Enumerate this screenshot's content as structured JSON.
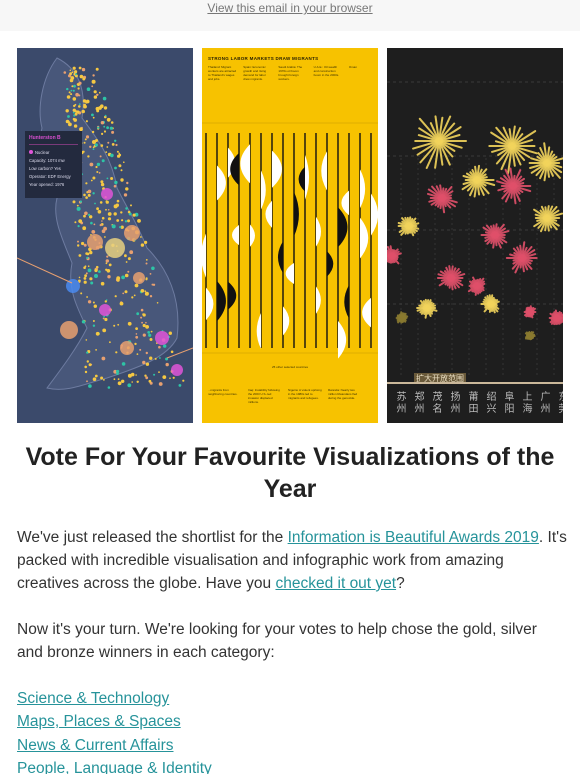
{
  "header": {
    "view_in_browser": "View this email in your browser"
  },
  "images": [
    {
      "name": "uk-power-map",
      "tooltip": {
        "title": "Hunterston B",
        "type": "Nuclear",
        "capacity": "Capacity: 1074 mw",
        "low_carbon": "Low carbon? Yes",
        "operator": "Operator: EDF Energy",
        "year": "Year opened: 1976"
      },
      "colors": {
        "background": "#3b4a6b",
        "nuclear": "#e055d8",
        "accent_teal": "#2ec4a6",
        "accent_yellow": "#f5c842",
        "accent_orange": "#e8a070"
      }
    },
    {
      "name": "migrants-chart",
      "title": "STRONG LABOR MARKETS DRAW MIGRANTS",
      "top_columns": [
        "Thailand: Migrant workers are attracted to Thailand's wages and jobs.",
        "Spain: Economic growth and rising demand for labor drew migrants.",
        "Saudi Arabia: The 1970s oil boom brought foreign workers.",
        "U.A.E.: Oil wealth and construction boom in the 2000s.",
        "Oman"
      ],
      "note": "25 other selected countries",
      "bottom_columns": [
        "...migrants from neighboring countries.",
        "Iraq: Instability following the 2003 U.S.-led invasion displaced millions.",
        "Nigeria: A violent uprising in the 1980s led to migrants and refugees.",
        "Rwanda: Nearly two million Rwandans fled during the genocide."
      ],
      "colors": {
        "background": "#f7c200",
        "ink": "#111111",
        "highlight": "#ffffff"
      }
    },
    {
      "name": "china-burst-chart",
      "axis_label": "扩大开放范围",
      "cities": [
        [
          "苏",
          "州"
        ],
        [
          "郑",
          "州"
        ],
        [
          "茂",
          "名"
        ],
        [
          "扬",
          "州"
        ],
        [
          "莆",
          "田"
        ],
        [
          "绍",
          "兴"
        ],
        [
          "阜",
          "阳"
        ],
        [
          "上",
          "海"
        ],
        [
          "广",
          "州"
        ],
        [
          "东",
          "莞"
        ]
      ],
      "colors": {
        "background": "#1e1e1e",
        "yellow": "#f2d45c",
        "pink": "#e0506a",
        "olive": "#8a7a30"
      }
    }
  ],
  "headline": "Vote For Your Favourite Visualizations of the Year",
  "paragraph1": {
    "before_link": "We've just released the shortlist for the ",
    "link1": "Information is Beautiful Awards 2019",
    "after_link1": ". It's packed with incredible visualisation and infographic work from amazing creatives across the globe. Have you ",
    "link2": "checked it out yet",
    "after_link2": "?"
  },
  "paragraph2": "Now it's your turn. We're looking for your votes to help chose the gold, silver and bronze winners in each category:",
  "categories": [
    "Science & Technology",
    "Maps, Places & Spaces",
    "News & Current Affairs",
    "People, Language & Identity"
  ],
  "colors": {
    "link": "#26939a",
    "text": "#333333",
    "heading": "#222222",
    "topbar": "#f7f7f7"
  }
}
